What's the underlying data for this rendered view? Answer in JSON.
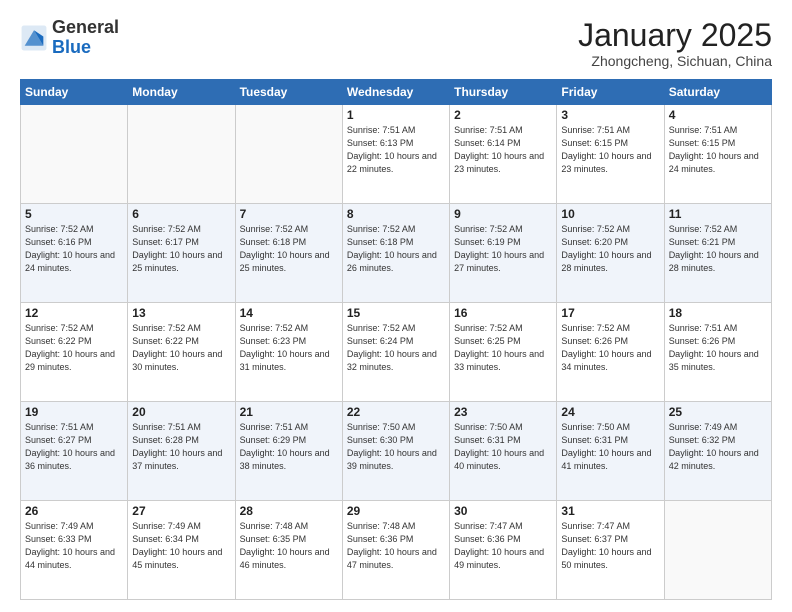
{
  "header": {
    "logo": {
      "general": "General",
      "blue": "Blue"
    },
    "title": "January 2025",
    "subtitle": "Zhongcheng, Sichuan, China"
  },
  "columns": [
    "Sunday",
    "Monday",
    "Tuesday",
    "Wednesday",
    "Thursday",
    "Friday",
    "Saturday"
  ],
  "weeks": [
    [
      {
        "day": "",
        "empty": true
      },
      {
        "day": "",
        "empty": true
      },
      {
        "day": "",
        "empty": true
      },
      {
        "day": "1",
        "sunrise": "7:51 AM",
        "sunset": "6:13 PM",
        "daylight": "10 hours and 22 minutes."
      },
      {
        "day": "2",
        "sunrise": "7:51 AM",
        "sunset": "6:14 PM",
        "daylight": "10 hours and 23 minutes."
      },
      {
        "day": "3",
        "sunrise": "7:51 AM",
        "sunset": "6:15 PM",
        "daylight": "10 hours and 23 minutes."
      },
      {
        "day": "4",
        "sunrise": "7:51 AM",
        "sunset": "6:15 PM",
        "daylight": "10 hours and 24 minutes."
      }
    ],
    [
      {
        "day": "5",
        "sunrise": "7:52 AM",
        "sunset": "6:16 PM",
        "daylight": "10 hours and 24 minutes."
      },
      {
        "day": "6",
        "sunrise": "7:52 AM",
        "sunset": "6:17 PM",
        "daylight": "10 hours and 25 minutes."
      },
      {
        "day": "7",
        "sunrise": "7:52 AM",
        "sunset": "6:18 PM",
        "daylight": "10 hours and 25 minutes."
      },
      {
        "day": "8",
        "sunrise": "7:52 AM",
        "sunset": "6:18 PM",
        "daylight": "10 hours and 26 minutes."
      },
      {
        "day": "9",
        "sunrise": "7:52 AM",
        "sunset": "6:19 PM",
        "daylight": "10 hours and 27 minutes."
      },
      {
        "day": "10",
        "sunrise": "7:52 AM",
        "sunset": "6:20 PM",
        "daylight": "10 hours and 28 minutes."
      },
      {
        "day": "11",
        "sunrise": "7:52 AM",
        "sunset": "6:21 PM",
        "daylight": "10 hours and 28 minutes."
      }
    ],
    [
      {
        "day": "12",
        "sunrise": "7:52 AM",
        "sunset": "6:22 PM",
        "daylight": "10 hours and 29 minutes."
      },
      {
        "day": "13",
        "sunrise": "7:52 AM",
        "sunset": "6:22 PM",
        "daylight": "10 hours and 30 minutes."
      },
      {
        "day": "14",
        "sunrise": "7:52 AM",
        "sunset": "6:23 PM",
        "daylight": "10 hours and 31 minutes."
      },
      {
        "day": "15",
        "sunrise": "7:52 AM",
        "sunset": "6:24 PM",
        "daylight": "10 hours and 32 minutes."
      },
      {
        "day": "16",
        "sunrise": "7:52 AM",
        "sunset": "6:25 PM",
        "daylight": "10 hours and 33 minutes."
      },
      {
        "day": "17",
        "sunrise": "7:52 AM",
        "sunset": "6:26 PM",
        "daylight": "10 hours and 34 minutes."
      },
      {
        "day": "18",
        "sunrise": "7:51 AM",
        "sunset": "6:26 PM",
        "daylight": "10 hours and 35 minutes."
      }
    ],
    [
      {
        "day": "19",
        "sunrise": "7:51 AM",
        "sunset": "6:27 PM",
        "daylight": "10 hours and 36 minutes."
      },
      {
        "day": "20",
        "sunrise": "7:51 AM",
        "sunset": "6:28 PM",
        "daylight": "10 hours and 37 minutes."
      },
      {
        "day": "21",
        "sunrise": "7:51 AM",
        "sunset": "6:29 PM",
        "daylight": "10 hours and 38 minutes."
      },
      {
        "day": "22",
        "sunrise": "7:50 AM",
        "sunset": "6:30 PM",
        "daylight": "10 hours and 39 minutes."
      },
      {
        "day": "23",
        "sunrise": "7:50 AM",
        "sunset": "6:31 PM",
        "daylight": "10 hours and 40 minutes."
      },
      {
        "day": "24",
        "sunrise": "7:50 AM",
        "sunset": "6:31 PM",
        "daylight": "10 hours and 41 minutes."
      },
      {
        "day": "25",
        "sunrise": "7:49 AM",
        "sunset": "6:32 PM",
        "daylight": "10 hours and 42 minutes."
      }
    ],
    [
      {
        "day": "26",
        "sunrise": "7:49 AM",
        "sunset": "6:33 PM",
        "daylight": "10 hours and 44 minutes."
      },
      {
        "day": "27",
        "sunrise": "7:49 AM",
        "sunset": "6:34 PM",
        "daylight": "10 hours and 45 minutes."
      },
      {
        "day": "28",
        "sunrise": "7:48 AM",
        "sunset": "6:35 PM",
        "daylight": "10 hours and 46 minutes."
      },
      {
        "day": "29",
        "sunrise": "7:48 AM",
        "sunset": "6:36 PM",
        "daylight": "10 hours and 47 minutes."
      },
      {
        "day": "30",
        "sunrise": "7:47 AM",
        "sunset": "6:36 PM",
        "daylight": "10 hours and 49 minutes."
      },
      {
        "day": "31",
        "sunrise": "7:47 AM",
        "sunset": "6:37 PM",
        "daylight": "10 hours and 50 minutes."
      },
      {
        "day": "",
        "empty": true
      }
    ]
  ],
  "row_styles": [
    "row-white",
    "row-shaded",
    "row-white",
    "row-shaded",
    "row-white"
  ]
}
